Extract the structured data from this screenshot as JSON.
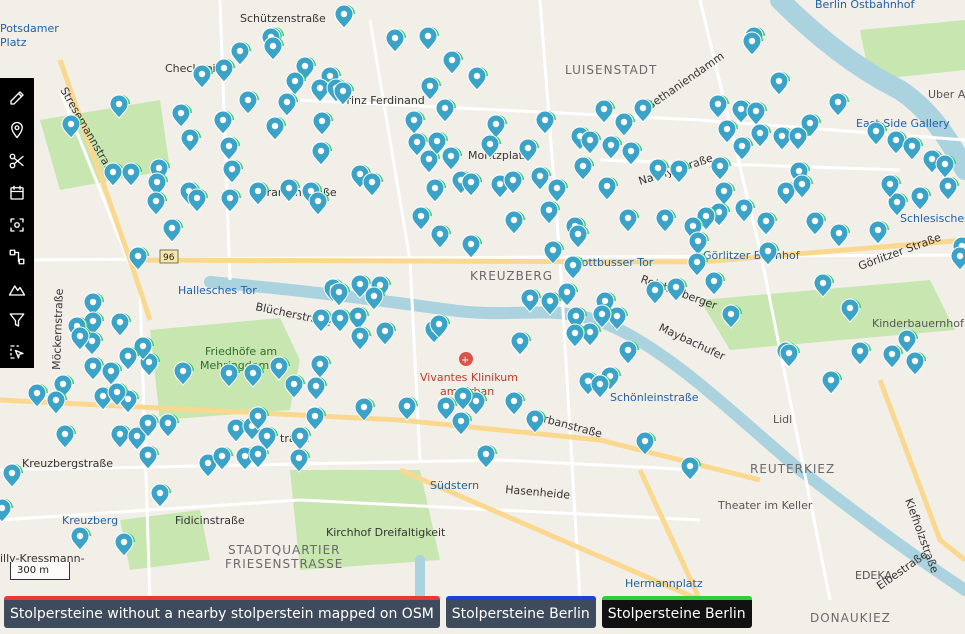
{
  "map": {
    "labels": {
      "potsdamer_platz_1": "Potsdamer",
      "potsdamer_platz_2": "Platz",
      "schuetzenstrasse": "Schützenstraße",
      "checkpoint": "Checkpoint",
      "stresemannstrasse": "Stresemannstraße",
      "luisenstadt": "LUISENSTADT",
      "prinz_ferdinand": "Prinz Ferdinand",
      "bethaniendamm": "Bethaniendamm",
      "uber_a": "Uber A",
      "berlin_ostbahnhof": "Berlin Ostbahnhof",
      "east_side_gallery": "East Side Gallery",
      "moritzplatz": "Moritzplatz",
      "naunynstrasse": "Naunynstraße",
      "oranienstrasse": "Oranienstraße",
      "schlesisches_tor": "Schlesisches Tor",
      "kottbusser_tor": "Kottbusser Tor",
      "goerlitzer_bahnhof": "Görlitzer Bahnhof",
      "goerlitzer_strasse": "Görlitzer Straße",
      "kreuzberg_district": "KREUZBERG",
      "hallesches_tor": "Hallesches Tor",
      "bluecherstrasse": "Blücherstraße",
      "reichenberger": "Reichenberger",
      "maybachufer": "Maybachufer",
      "kinderbauernhof": "Kinderbauernhof",
      "friedhoefe_1": "Friedhöfe am",
      "friedhoefe_2": "Mehringdamm",
      "vivantes_1": "Vivantes Klinikum",
      "vivantes_2": "am Urban",
      "schoenleinstrasse": "Schönleinstraße",
      "urbanstrasse": "Urbanstraße",
      "lidl": "Lidl",
      "moeckernstrasse": "Möckernstraße",
      "kreuzbergstrasse": "Kreuzbergstraße",
      "suedstern": "Südstern",
      "hasenheide": "Hasenheide",
      "reuterkiez": "REUTERKIEZ",
      "theater_im_keller": "Theater im Keller",
      "kiefholz": "Kiefholzstraße",
      "kreuzberg_park": "Kreuzberg",
      "fidicinstrasse": "Fidicinstraße",
      "kirchhof": "Kirchhof Dreifaltigkeit",
      "stadtquartier_1": "STADTQUARTIER",
      "stadtquartier_2": "FRIESENSTRASSE",
      "hermannplatz": "Hermannplatz",
      "edeka": "EDEKA",
      "elbestrasse": "Elbestraße",
      "donaukiez": "DONAUKIEZ",
      "illy_kressmann": "illy-Kressmann-",
      "road_96": "96",
      "trasse": "traße"
    },
    "colors": {
      "background": "#f2efe9",
      "park": "#c8e6b0",
      "water": "#aad3df",
      "road_major": "#fbd88f",
      "road_minor": "#ffffff",
      "marker_fill": "#3aa3c7",
      "marker_inner": "#ffffff",
      "marker_accent": "#2ecc71"
    }
  },
  "toolbar": {
    "tools": [
      {
        "icon": "pencil-icon"
      },
      {
        "icon": "map-pin-icon"
      },
      {
        "icon": "scissors-icon"
      },
      {
        "icon": "calendar-icon"
      },
      {
        "icon": "scan-icon"
      },
      {
        "icon": "route-icon"
      },
      {
        "icon": "mountain-icon"
      },
      {
        "icon": "filter-icon"
      },
      {
        "icon": "select-icon"
      }
    ]
  },
  "scale": {
    "label": "300 m"
  },
  "layers": [
    {
      "label": "Stolpersteine without a nearby stolperstein mapped on OSM",
      "accent": "#e53935",
      "bg": "#3d4b5c"
    },
    {
      "label": "Stolpersteine Berlin",
      "accent": "#1e3fd8",
      "bg": "#3d4b5c"
    },
    {
      "label": "Stolpersteine Berlin",
      "accent": "#2ecc40",
      "bg": "#111111"
    }
  ]
}
